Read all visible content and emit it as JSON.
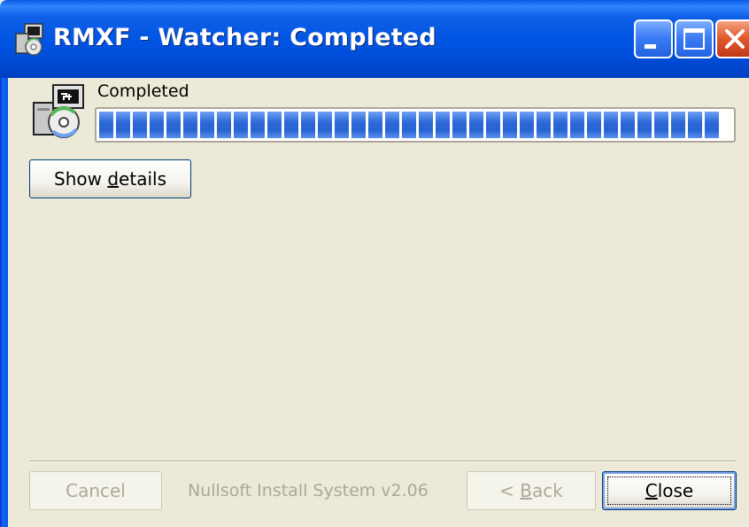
{
  "window": {
    "title": "RMXF - Watcher: Completed",
    "icon": "installer-icon",
    "controls": [
      "minimize-icon",
      "maximize-icon",
      "close-icon"
    ]
  },
  "status": {
    "text": "Completed",
    "icon": "installer-cd-icon",
    "progress_percent": 100
  },
  "buttons": {
    "show_details": {
      "prefix": "Show ",
      "accel": "d",
      "suffix": "etails"
    },
    "cancel": "Cancel",
    "back": {
      "prefix": "< ",
      "accel": "B",
      "suffix": "ack"
    },
    "close": {
      "accel": "C",
      "suffix": "lose"
    }
  },
  "branding": "Nullsoft Install System v2.06",
  "colors": {
    "titlebar": "#0054E3",
    "progress_fill": "#2C68D8",
    "dialog_bg": "#ECE9D8",
    "close_button": "#E35C2F"
  }
}
